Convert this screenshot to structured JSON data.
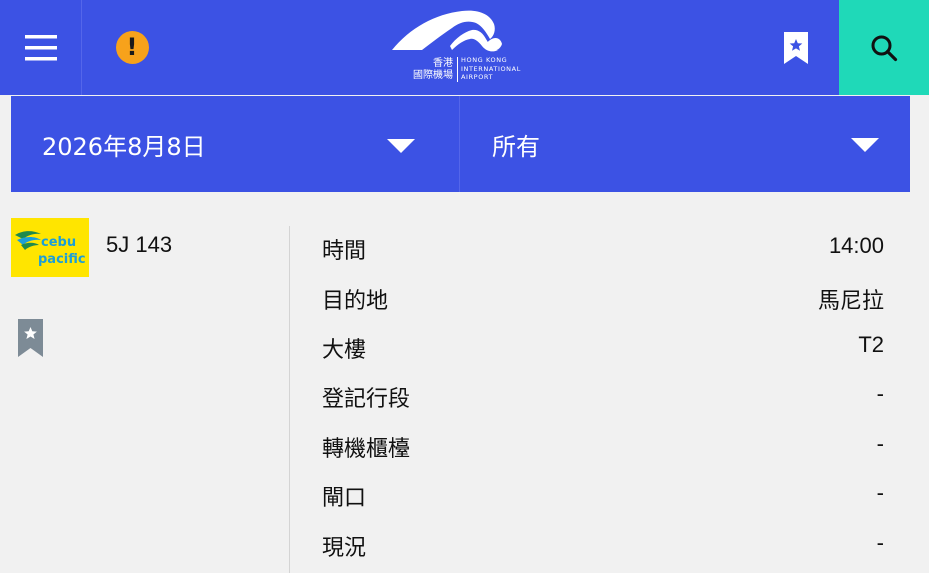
{
  "header": {
    "logo": {
      "name_zh_line1": "香港",
      "name_zh_line2": "國際機場",
      "name_en_line1": "HONG KONG",
      "name_en_line2": "INTERNATIONAL",
      "name_en_line3": "AIRPORT"
    },
    "alert_symbol": "!",
    "colors": {
      "bar": "#3c52e4",
      "search": "#1fd9b8",
      "alert": "#f7a21b"
    }
  },
  "filters": {
    "date": "2026年8月8日",
    "type": "所有"
  },
  "flight": {
    "airline_logo": {
      "line1": "cebu",
      "line2": "pacific"
    },
    "number": "5J 143",
    "details": [
      {
        "label": "時間",
        "value": "14:00"
      },
      {
        "label": "目的地",
        "value": "馬尼拉"
      },
      {
        "label": "大樓",
        "value": "T2"
      },
      {
        "label": "登記行段",
        "value": "-"
      },
      {
        "label": "轉機櫃檯",
        "value": "-"
      },
      {
        "label": "閘口",
        "value": "-"
      },
      {
        "label": "現況",
        "value": "-"
      }
    ]
  }
}
